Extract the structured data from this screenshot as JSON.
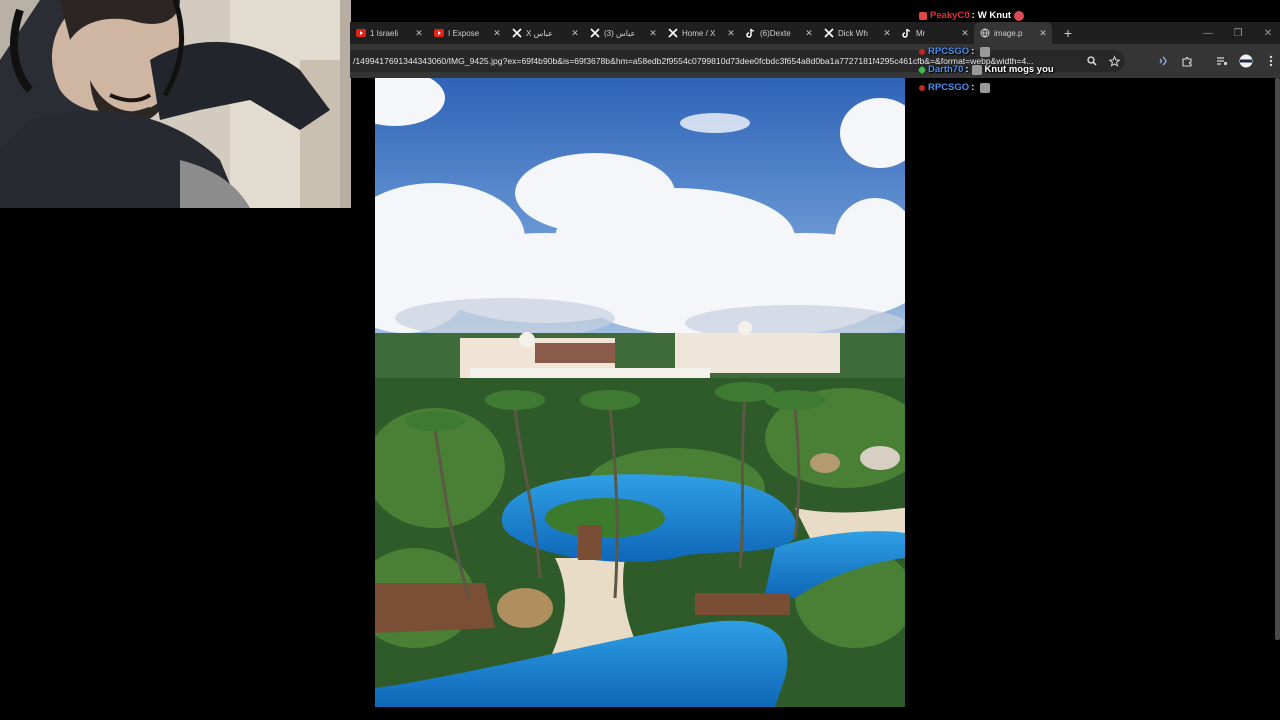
{
  "browser": {
    "tabs": [
      {
        "label": "1 Israeli",
        "favicon": "youtube-icon"
      },
      {
        "label": "I Expose",
        "favicon": "youtube-icon"
      },
      {
        "label": "X عباس",
        "favicon": "x-icon"
      },
      {
        "label": "(3) عباس",
        "favicon": "x-icon"
      },
      {
        "label": "Home / X",
        "favicon": "x-icon"
      },
      {
        "label": "(6)Dexte",
        "favicon": "tiktok-icon"
      },
      {
        "label": "Dick Wh",
        "favicon": "x-icon"
      },
      {
        "label": "Mr",
        "favicon": "tiktok-icon"
      },
      {
        "label": "image.p",
        "favicon": "globe-icon"
      }
    ],
    "address_text": "/1499417691344343060/IMG_9425.jpg?ex=69f4b90b&is=69f3678b&hm=a58edb2f9554c0799810d73dee0fcbdc3f654a8d0ba1a7727181f4295c461cfb&=&format=webp&width=4...",
    "colors": {
      "tabbar": "#1f1f1f",
      "toolbar": "#353535",
      "accent": "#8ab4f8"
    }
  },
  "chat": [
    {
      "user": "PeakyC0",
      "message": "W Knut",
      "user_color": "#e0303a",
      "badge": "#e04848",
      "emote": true
    },
    {
      "user": "RPCSGO",
      "message": "",
      "user_color": "#4a8ff0",
      "badge": "#c02828",
      "emote": true
    },
    {
      "user": "Darth70",
      "message": "Knut mogs you",
      "user_color": "#4a8ff0",
      "badge": "#3fbf4a",
      "emote": true
    },
    {
      "user": "RPCSGO",
      "message": "",
      "user_color": "#4a8ff0",
      "badge": "#c02828",
      "emote": true
    }
  ]
}
